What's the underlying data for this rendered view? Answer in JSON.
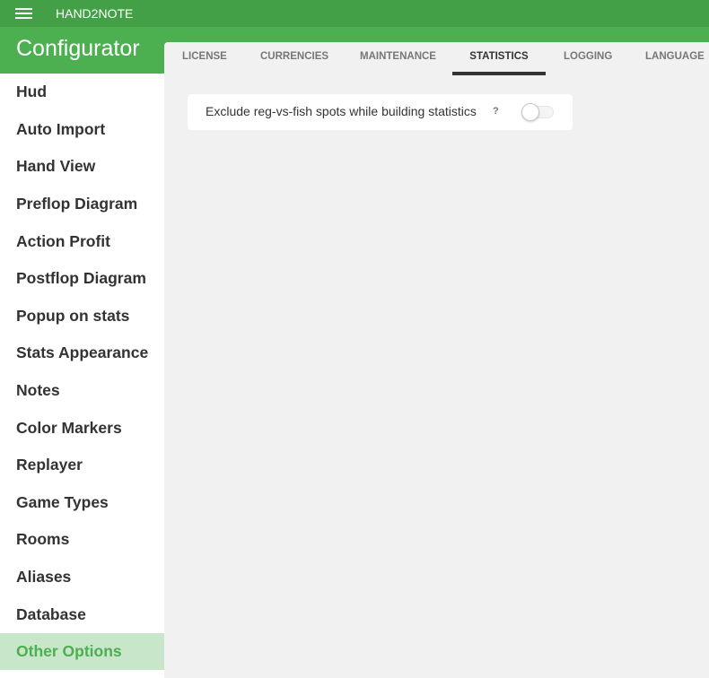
{
  "app": {
    "name": "HAND2NOTE",
    "menu_icon": "hamburger-menu-icon"
  },
  "sidebar": {
    "title": "Configurator",
    "items": [
      {
        "label": "Hud",
        "active": false
      },
      {
        "label": "Auto Import",
        "active": false
      },
      {
        "label": "Hand View",
        "active": false
      },
      {
        "label": "Preflop Diagram",
        "active": false
      },
      {
        "label": "Action Profit",
        "active": false
      },
      {
        "label": "Postflop Diagram",
        "active": false
      },
      {
        "label": "Popup on stats",
        "active": false
      },
      {
        "label": "Stats Appearance",
        "active": false
      },
      {
        "label": "Notes",
        "active": false
      },
      {
        "label": "Color Markers",
        "active": false
      },
      {
        "label": "Replayer",
        "active": false
      },
      {
        "label": "Game Types",
        "active": false
      },
      {
        "label": "Rooms",
        "active": false
      },
      {
        "label": "Aliases",
        "active": false
      },
      {
        "label": "Database",
        "active": false
      },
      {
        "label": "Other Options",
        "active": true
      }
    ]
  },
  "tabs": [
    {
      "label": "LICENSE",
      "active": false
    },
    {
      "label": "CURRENCIES",
      "active": false
    },
    {
      "label": "MAINTENANCE",
      "active": false
    },
    {
      "label": "STATISTICS",
      "active": true
    },
    {
      "label": "LOGGING",
      "active": false
    },
    {
      "label": "LANGUAGE",
      "active": false
    }
  ],
  "settings": {
    "exclude_reg_vs_fish": {
      "label": "Exclude reg-vs-fish spots while building statistics",
      "help": "?",
      "enabled": false
    }
  },
  "colors": {
    "topbar": "#43a047",
    "header": "#4caf50",
    "active_item_bg": "#c8e6c9",
    "active_item_text": "#4caf50",
    "content_bg": "#f1f1f1"
  }
}
